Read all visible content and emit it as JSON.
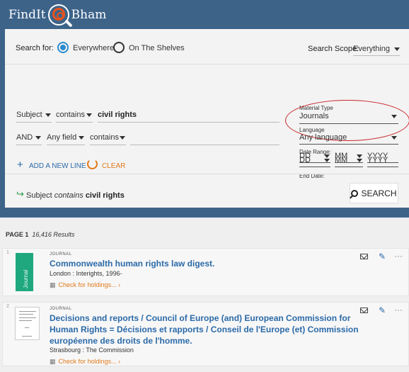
{
  "header": {
    "logo_left": "FindIt",
    "logo_right": "Bham"
  },
  "search_panel": {
    "search_for_label": "Search for:",
    "options": [
      {
        "label": "Everywhere",
        "selected": true
      },
      {
        "label": "On The Shelves",
        "selected": false
      }
    ],
    "scope_label": "Search Scope:",
    "scope_value": "Everything",
    "lines": [
      {
        "field": "Subject",
        "operator": "contains",
        "value": "civil rights"
      },
      {
        "boolean": "AND",
        "field": "Any field",
        "operator": "contains",
        "value": ""
      }
    ],
    "add_line_label": "ADD A NEW LINE",
    "clear_label": "CLEAR",
    "material_type_label": "Material Type",
    "material_type_value": "Journals",
    "language_label": "Language",
    "language_value": "Any language",
    "date_range_label": "Date Range:",
    "end_date_label": "End Date:",
    "date_fields": {
      "day": "DD",
      "month": "MM",
      "year": "YYYY"
    },
    "summary": {
      "field": "Subject",
      "op": "contains",
      "value": "civil rights"
    },
    "search_button": "SEARCH"
  },
  "results": {
    "page_label": "PAGE 1",
    "count_text": "16,416 Results",
    "items": [
      {
        "num": "1",
        "type": "JOURNAL",
        "thumb_label": "Journal",
        "title": "Commonwealth human rights law digest.",
        "publisher": "London : Interights, 1996-",
        "holdings": "Check for holdings..."
      },
      {
        "num": "2",
        "type": "JOURNAL",
        "title_lines": [
          "Decisions and reports / Council of Europe (and) European Commission for",
          "Human Rights = Décisions et rapports / Conseil de l'Europe (et) Commission",
          "européenne des droits de l'homme."
        ],
        "publisher": "Strasbourg : The Commission",
        "holdings": "Check for holdings..."
      }
    ]
  },
  "colors": {
    "brand": "#3d6389",
    "accent": "#2b8ccf",
    "orange": "#e07a1b",
    "thumb_green": "#1fa87e",
    "oval": "#c9262b"
  },
  "icons": [
    "magnifier-logo-icon",
    "radio-icon",
    "caret-down-icon",
    "plus-icon",
    "refresh-icon",
    "arrow-right-icon",
    "search-icon",
    "book-icon",
    "email-icon",
    "pin-icon",
    "more-icon"
  ]
}
